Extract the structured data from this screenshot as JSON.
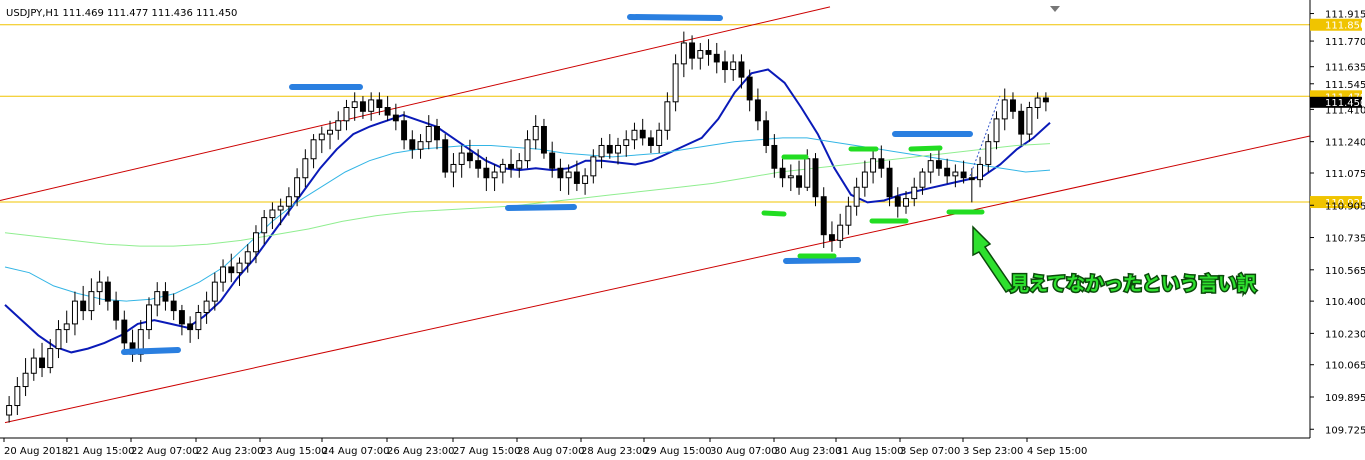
{
  "chart_data": {
    "type": "candlestick",
    "title": "USDJPY,H1  111.469 111.477 111.436 111.450",
    "ylim": [
      109.7,
      111.96
    ],
    "y_ticks": [
      "111.915",
      "111.770",
      "111.635",
      "111.545",
      "111.410",
      "111.240",
      "111.075",
      "110.905",
      "110.735",
      "110.565",
      "110.400",
      "110.230",
      "110.065",
      "109.895",
      "109.725"
    ],
    "x_ticks": [
      "20 Aug 2018",
      "21 Aug 15:00",
      "22 Aug 07:00",
      "22 Aug 23:00",
      "23 Aug 15:00",
      "24 Aug 07:00",
      "26 Aug 23:00",
      "27 Aug 15:00",
      "28 Aug 07:00",
      "28 Aug 23:00",
      "29 Aug 15:00",
      "30 Aug 07:00",
      "30 Aug 23:00",
      "31 Aug 15:00",
      "3 Sep 07:00",
      "3 Sep 23:00",
      "4 Sep 15:00"
    ],
    "horizontal_levels": [
      {
        "price": 111.856,
        "label": "111.856",
        "color": "#f0c400"
      },
      {
        "price": 111.479,
        "label": "111.479",
        "color": "#f0c400"
      },
      {
        "price": 110.922,
        "label": "110.922",
        "color": "#f0c400"
      }
    ],
    "current_price_label": "111.450",
    "candles": [
      [
        109.8,
        109.9,
        109.76,
        109.85
      ],
      [
        109.85,
        110.0,
        109.8,
        109.95
      ],
      [
        109.95,
        110.1,
        109.9,
        110.02
      ],
      [
        110.02,
        110.15,
        109.98,
        110.1
      ],
      [
        110.1,
        110.18,
        110.0,
        110.05
      ],
      [
        110.05,
        110.2,
        110.02,
        110.15
      ],
      [
        110.15,
        110.3,
        110.1,
        110.25
      ],
      [
        110.25,
        110.35,
        110.18,
        110.28
      ],
      [
        110.28,
        110.45,
        110.22,
        110.4
      ],
      [
        110.4,
        110.48,
        110.3,
        110.35
      ],
      [
        110.35,
        110.52,
        110.3,
        110.45
      ],
      [
        110.45,
        110.56,
        110.38,
        110.5
      ],
      [
        110.5,
        110.53,
        110.35,
        110.4
      ],
      [
        110.4,
        110.45,
        110.25,
        110.3
      ],
      [
        110.3,
        110.35,
        110.12,
        110.18
      ],
      [
        110.18,
        110.25,
        110.08,
        110.12
      ],
      [
        110.12,
        110.3,
        110.08,
        110.25
      ],
      [
        110.25,
        110.42,
        110.2,
        110.38
      ],
      [
        110.38,
        110.5,
        110.32,
        110.45
      ],
      [
        110.45,
        110.5,
        110.35,
        110.4
      ],
      [
        110.4,
        110.44,
        110.3,
        110.35
      ],
      [
        110.35,
        110.38,
        110.22,
        110.28
      ],
      [
        110.28,
        110.32,
        110.18,
        110.25
      ],
      [
        110.25,
        110.38,
        110.2,
        110.34
      ],
      [
        110.34,
        110.45,
        110.28,
        110.4
      ],
      [
        110.4,
        110.55,
        110.35,
        110.5
      ],
      [
        110.5,
        110.62,
        110.45,
        110.58
      ],
      [
        110.58,
        110.65,
        110.5,
        110.55
      ],
      [
        110.55,
        110.63,
        110.48,
        110.6
      ],
      [
        110.6,
        110.7,
        110.55,
        110.66
      ],
      [
        110.66,
        110.8,
        110.6,
        110.76
      ],
      [
        110.76,
        110.88,
        110.7,
        110.84
      ],
      [
        110.84,
        110.92,
        110.78,
        110.88
      ],
      [
        110.88,
        110.94,
        110.8,
        110.9
      ],
      [
        110.9,
        111.0,
        110.85,
        110.95
      ],
      [
        110.95,
        111.1,
        110.9,
        111.05
      ],
      [
        111.05,
        111.2,
        111.0,
        111.15
      ],
      [
        111.15,
        111.28,
        111.1,
        111.25
      ],
      [
        111.25,
        111.32,
        111.18,
        111.28
      ],
      [
        111.28,
        111.35,
        111.2,
        111.3
      ],
      [
        111.3,
        111.4,
        111.25,
        111.35
      ],
      [
        111.35,
        111.46,
        111.3,
        111.42
      ],
      [
        111.42,
        111.5,
        111.35,
        111.45
      ],
      [
        111.45,
        111.48,
        111.36,
        111.4
      ],
      [
        111.4,
        111.5,
        111.35,
        111.46
      ],
      [
        111.46,
        111.5,
        111.38,
        111.42
      ],
      [
        111.42,
        111.48,
        111.35,
        111.38
      ],
      [
        111.38,
        111.44,
        111.3,
        111.35
      ],
      [
        111.35,
        111.4,
        111.2,
        111.25
      ],
      [
        111.25,
        111.3,
        111.15,
        111.2
      ],
      [
        111.2,
        111.28,
        111.15,
        111.24
      ],
      [
        111.24,
        111.38,
        111.2,
        111.32
      ],
      [
        111.32,
        111.36,
        111.2,
        111.25
      ],
      [
        111.25,
        111.28,
        111.05,
        111.08
      ],
      [
        111.08,
        111.18,
        111.0,
        111.12
      ],
      [
        111.12,
        111.22,
        111.05,
        111.18
      ],
      [
        111.18,
        111.25,
        111.1,
        111.14
      ],
      [
        111.14,
        111.2,
        111.05,
        111.1
      ],
      [
        111.1,
        111.16,
        110.98,
        111.05
      ],
      [
        111.05,
        111.12,
        110.98,
        111.08
      ],
      [
        111.08,
        111.15,
        111.02,
        111.12
      ],
      [
        111.12,
        111.2,
        111.05,
        111.1
      ],
      [
        111.1,
        111.18,
        111.05,
        111.14
      ],
      [
        111.14,
        111.3,
        111.1,
        111.25
      ],
      [
        111.25,
        111.38,
        111.2,
        111.32
      ],
      [
        111.32,
        111.36,
        111.15,
        111.18
      ],
      [
        111.18,
        111.24,
        111.05,
        111.1
      ],
      [
        111.1,
        111.15,
        110.98,
        111.05
      ],
      [
        111.05,
        111.12,
        110.96,
        111.08
      ],
      [
        111.08,
        111.14,
        110.98,
        111.02
      ],
      [
        111.02,
        111.1,
        110.96,
        111.06
      ],
      [
        111.06,
        111.2,
        111.02,
        111.16
      ],
      [
        111.16,
        111.26,
        111.1,
        111.22
      ],
      [
        111.22,
        111.28,
        111.15,
        111.18
      ],
      [
        111.18,
        111.26,
        111.12,
        111.22
      ],
      [
        111.22,
        111.3,
        111.16,
        111.25
      ],
      [
        111.25,
        111.34,
        111.2,
        111.3
      ],
      [
        111.3,
        111.36,
        111.22,
        111.26
      ],
      [
        111.26,
        111.3,
        111.18,
        111.22
      ],
      [
        111.22,
        111.34,
        111.18,
        111.3
      ],
      [
        111.3,
        111.5,
        111.25,
        111.45
      ],
      [
        111.45,
        111.7,
        111.4,
        111.65
      ],
      [
        111.65,
        111.82,
        111.58,
        111.76
      ],
      [
        111.76,
        111.8,
        111.62,
        111.68
      ],
      [
        111.68,
        111.76,
        111.62,
        111.72
      ],
      [
        111.72,
        111.78,
        111.64,
        111.7
      ],
      [
        111.7,
        111.76,
        111.6,
        111.66
      ],
      [
        111.66,
        111.72,
        111.55,
        111.62
      ],
      [
        111.62,
        111.7,
        111.56,
        111.66
      ],
      [
        111.66,
        111.7,
        111.52,
        111.58
      ],
      [
        111.58,
        111.62,
        111.4,
        111.46
      ],
      [
        111.46,
        111.52,
        111.3,
        111.35
      ],
      [
        111.35,
        111.4,
        111.18,
        111.22
      ],
      [
        111.22,
        111.28,
        111.05,
        111.1
      ],
      [
        111.1,
        111.16,
        111.0,
        111.05
      ],
      [
        111.05,
        111.12,
        110.98,
        111.06
      ],
      [
        111.06,
        111.14,
        110.96,
        111.0
      ],
      [
        111.0,
        111.2,
        110.98,
        111.15
      ],
      [
        111.15,
        111.18,
        110.9,
        110.95
      ],
      [
        110.95,
        111.0,
        110.68,
        110.75
      ],
      [
        110.75,
        110.82,
        110.66,
        110.72
      ],
      [
        110.72,
        110.86,
        110.68,
        110.8
      ],
      [
        110.8,
        110.95,
        110.75,
        110.9
      ],
      [
        110.9,
        111.05,
        110.85,
        111.0
      ],
      [
        111.0,
        111.14,
        110.95,
        111.08
      ],
      [
        111.08,
        111.2,
        111.02,
        111.15
      ],
      [
        111.15,
        111.22,
        111.05,
        111.1
      ],
      [
        111.1,
        111.14,
        110.9,
        110.95
      ],
      [
        110.95,
        111.0,
        110.84,
        110.9
      ],
      [
        110.9,
        110.98,
        110.86,
        110.94
      ],
      [
        110.94,
        111.05,
        110.9,
        111.0
      ],
      [
        111.0,
        111.1,
        110.96,
        111.08
      ],
      [
        111.08,
        111.18,
        111.02,
        111.14
      ],
      [
        111.14,
        111.2,
        111.06,
        111.1
      ],
      [
        111.1,
        111.15,
        111.02,
        111.06
      ],
      [
        111.06,
        111.12,
        111.0,
        111.08
      ],
      [
        111.08,
        111.14,
        111.02,
        111.05
      ],
      [
        111.05,
        111.1,
        110.92,
        111.04
      ],
      [
        111.04,
        111.16,
        111.0,
        111.12
      ],
      [
        111.12,
        111.28,
        111.08,
        111.24
      ],
      [
        111.24,
        111.4,
        111.2,
        111.36
      ],
      [
        111.36,
        111.52,
        111.3,
        111.46
      ],
      [
        111.46,
        111.5,
        111.36,
        111.4
      ],
      [
        111.4,
        111.44,
        111.22,
        111.28
      ],
      [
        111.28,
        111.45,
        111.24,
        111.42
      ],
      [
        111.42,
        111.5,
        111.36,
        111.47
      ],
      [
        111.47,
        111.5,
        111.4,
        111.45
      ]
    ],
    "series": [
      {
        "values": [
          110.38,
          110.3,
          110.22,
          110.16,
          110.13,
          110.15,
          110.18,
          110.22,
          110.28,
          110.3,
          110.28,
          110.26,
          110.32,
          110.4,
          110.52,
          110.62,
          110.74,
          110.86,
          110.98,
          111.1,
          111.2,
          111.28,
          111.32,
          111.35,
          111.38,
          111.35,
          111.32,
          111.26,
          111.2,
          111.14,
          111.1,
          111.09,
          111.1,
          111.09,
          111.1,
          111.14,
          111.14,
          111.13,
          111.12,
          111.14,
          111.18,
          111.22,
          111.26,
          111.36,
          111.5,
          111.6,
          111.62,
          111.55,
          111.42,
          111.28,
          111.1,
          110.96,
          110.92,
          110.93,
          110.96,
          110.98,
          111.0,
          111.02,
          111.04,
          111.06,
          111.12,
          111.2,
          111.26,
          111.34
        ]
      },
      {
        "values": [
          110.58,
          110.55,
          110.48,
          110.44,
          110.41,
          110.4,
          110.41,
          110.44,
          110.5,
          110.58,
          110.7,
          110.82,
          110.92,
          111.0,
          111.08,
          111.14,
          111.18,
          111.2,
          111.21,
          111.22,
          111.22,
          111.21,
          111.2,
          111.18,
          111.17,
          111.16,
          111.17,
          111.18,
          111.2,
          111.22,
          111.24,
          111.25,
          111.26,
          111.26,
          111.24,
          111.22,
          111.2,
          111.18,
          111.16,
          111.14,
          111.12,
          111.1,
          111.08,
          111.09
        ]
      },
      {
        "values": [
          110.76,
          110.74,
          110.72,
          110.7,
          110.69,
          110.69,
          110.7,
          110.72,
          110.75,
          110.78,
          110.82,
          110.85,
          110.87,
          110.88,
          110.89,
          110.9,
          110.92,
          110.94,
          110.96,
          110.98,
          111.0,
          111.02,
          111.05,
          111.08,
          111.1,
          111.12,
          111.14,
          111.16,
          111.18,
          111.2,
          111.22,
          111.23
        ]
      }
    ],
    "annotations": [
      {
        "type": "text",
        "text": "見えてなかったという言い訳",
        "color": "#2ee02e"
      }
    ]
  }
}
